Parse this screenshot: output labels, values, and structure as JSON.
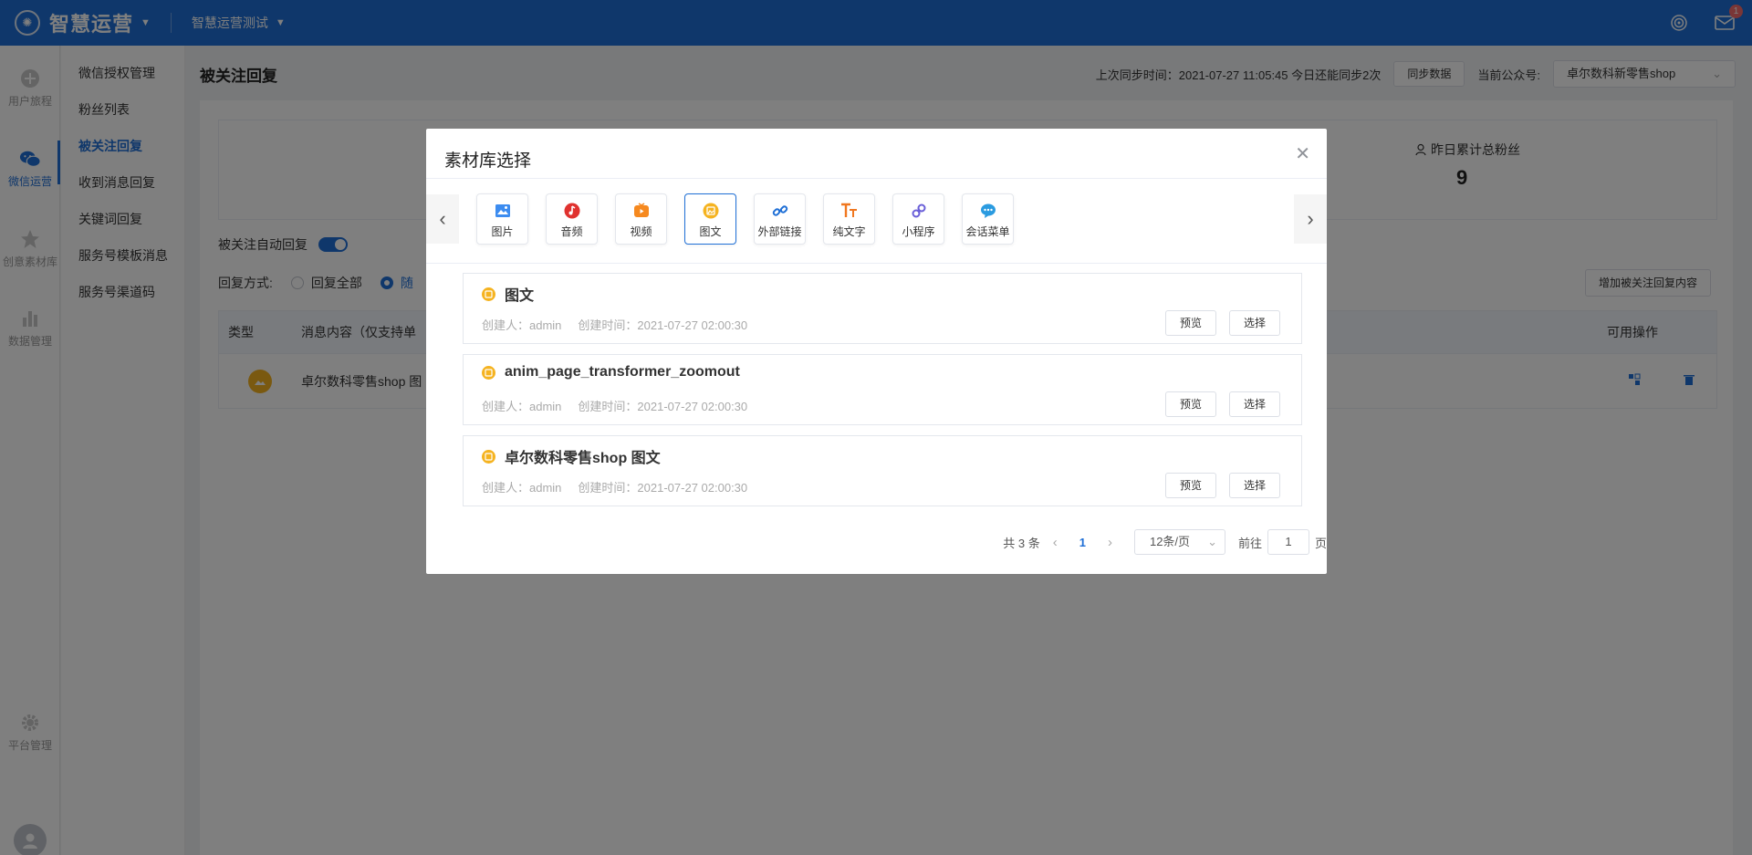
{
  "header": {
    "app_title": "智慧运营",
    "project_name": "智慧运营测试",
    "notification_count": "1"
  },
  "rail": {
    "items": [
      {
        "label": "用户旅程",
        "icon": "journey-icon"
      },
      {
        "label": "微信运营",
        "icon": "wechat-icon"
      },
      {
        "label": "创意素材库",
        "icon": "star-icon"
      },
      {
        "label": "数据管理",
        "icon": "bar-chart-icon"
      },
      {
        "label": "平台管理",
        "icon": "gear-icon"
      }
    ]
  },
  "submenu": {
    "items": [
      {
        "label": "微信授权管理"
      },
      {
        "label": "粉丝列表"
      },
      {
        "label": "被关注回复"
      },
      {
        "label": "收到消息回复"
      },
      {
        "label": "关键词回复"
      },
      {
        "label": "服务号模板消息"
      },
      {
        "label": "服务号渠道码"
      }
    ]
  },
  "page": {
    "title": "被关注回复",
    "sync_text": "上次同步时间：2021-07-27 11:05:45 今日还能同步2次",
    "sync_button": "同步数据",
    "account_label": "当前公众号:",
    "account_value": "卓尔数科新零售shop",
    "stat_label": "昨日累计总粉丝",
    "stat_value": "9",
    "auto_reply_label": "被关注自动回复",
    "reply_mode_label": "回复方式:",
    "reply_all_option": "回复全部",
    "reply_random_option": "随",
    "add_button": "增加被关注回复内容",
    "table_headers": {
      "type": "类型",
      "content": "消息内容（仅支持单",
      "ops": "可用操作"
    },
    "table_row": {
      "content": "卓尔数科零售shop 图"
    }
  },
  "dialog": {
    "title": "素材库选择",
    "tabs": [
      {
        "label": "图片",
        "icon": "image-icon",
        "color": "#3c8cf0"
      },
      {
        "label": "音频",
        "icon": "audio-icon",
        "color": "#e0322f"
      },
      {
        "label": "视频",
        "icon": "video-icon",
        "color": "#f6891f"
      },
      {
        "label": "图文",
        "icon": "article-icon",
        "color": "#f5b320"
      },
      {
        "label": "外部链接",
        "icon": "link-icon",
        "color": "#1f6fd6"
      },
      {
        "label": "纯文字",
        "icon": "text-icon",
        "color": "#f0771f"
      },
      {
        "label": "小程序",
        "icon": "miniprogram-icon",
        "color": "#6a5fd8"
      },
      {
        "label": "会话菜单",
        "icon": "chat-menu-icon",
        "color": "#2b9be0"
      }
    ],
    "active_tab": "图文",
    "items": [
      {
        "title": "图文",
        "creator": "创建人：admin",
        "created": "创建时间：2021-07-27 02:00:30"
      },
      {
        "title": "anim_page_transformer_zoomout",
        "creator": "创建人：admin",
        "created": "创建时间：2021-07-27 02:00:30"
      },
      {
        "title": "卓尔数科零售shop 图文",
        "creator": "创建人：admin",
        "created": "创建时间：2021-07-27 02:00:30"
      }
    ],
    "preview_label": "预览",
    "select_label": "选择",
    "pagination": {
      "total": "共 3 条",
      "current_page": "1",
      "page_size": "12条/页",
      "goto_label": "前往",
      "goto_value": "1",
      "page_suffix": "页"
    }
  }
}
